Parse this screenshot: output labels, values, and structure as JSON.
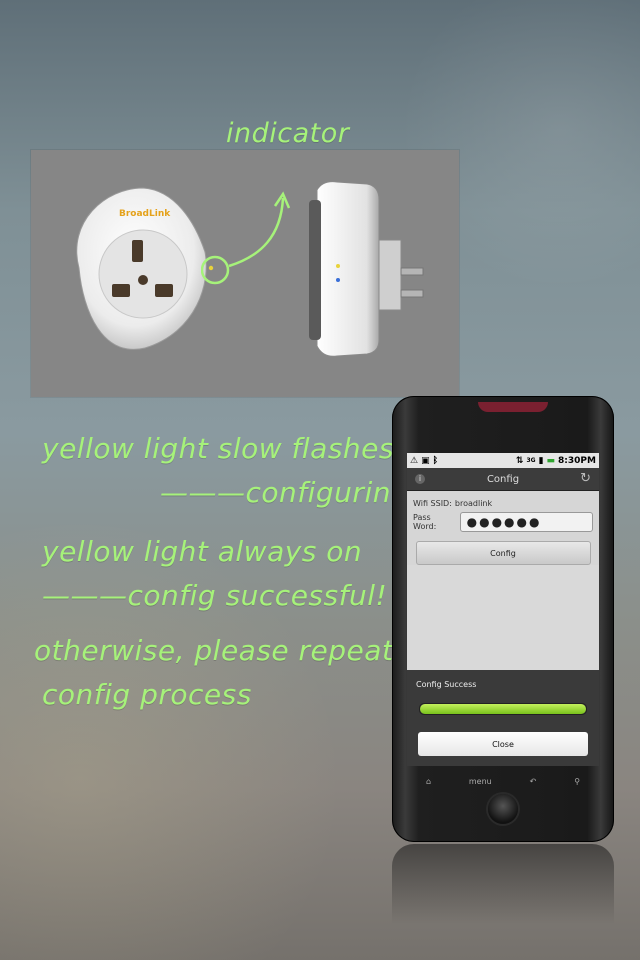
{
  "annotation": {
    "indicator": "indicator"
  },
  "instructions": {
    "line1": "yellow light slow flashes",
    "line2": "———configuring",
    "line3": "yellow light always on",
    "line4": "———config successful!",
    "line5": "otherwise, please repeat",
    "line6": "config process"
  },
  "product": {
    "brand": "BroadLink"
  },
  "phone": {
    "statusbar": {
      "time": "8:30PM",
      "icons": [
        "warning-icon",
        "image-icon",
        "bluetooth-icon",
        "sync-icon",
        "3g-icon",
        "signal-icon",
        "battery-icon"
      ]
    },
    "titlebar": {
      "title": "Config"
    },
    "form": {
      "ssid_label": "Wifi SSID:",
      "ssid_value": "broadlink",
      "password_label": "Pass Word:",
      "password_value": "●●●●●●",
      "config_button": "Config"
    },
    "dialog": {
      "title": "Config Success",
      "progress": 1.0,
      "close_button": "Close"
    },
    "navbar": {
      "menu_label": "menu"
    }
  },
  "colors": {
    "hand_text": "#a6f27a",
    "progress": "#8fd32a",
    "indicator_highlight": "#a6f27a"
  }
}
